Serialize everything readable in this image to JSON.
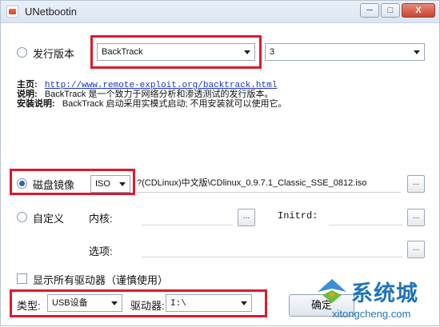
{
  "window": {
    "title": "UNetbootin",
    "minimize": "─",
    "maximize": "□",
    "close": "X"
  },
  "distribution": {
    "label": "发行版本",
    "selected": "BackTrack",
    "version": "3",
    "info": {
      "homepage_label": "主页:",
      "homepage_url": "http://www.remote-exploit.org/backtrack.html",
      "description_label": "说明:",
      "description_text": "BackTrack 是一个致力于网络分析和渗透测试的发行版本。",
      "install_label": "安装说明:",
      "install_text": "BackTrack 启动采用实模式启动; 不用安装就可以使用它。"
    }
  },
  "disk_image": {
    "label": "磁盘镜像",
    "type": "ISO",
    "path": "?(CDLinux)中文版\\CDlinux_0.9.7.1_Classic_SSE_0812.iso",
    "browse": "..."
  },
  "custom": {
    "label": "自定义",
    "kernel_label": "内核:",
    "initrd_label": "Initrd:",
    "options_label": "选项:",
    "browse": "..."
  },
  "show_all_drives": {
    "label": "显示所有驱动器（谨慎使用）"
  },
  "bottom": {
    "type_label": "类型:",
    "type_value": "USB设备",
    "drive_label": "驱动器:",
    "drive_value": "I:\\",
    "ok_label": "确定"
  },
  "watermark": {
    "brand": "系统城",
    "url": "xitongcheng.com"
  },
  "colors": {
    "highlight": "#e0182b",
    "link": "#1a33c9",
    "accent": "#2a62b8"
  }
}
